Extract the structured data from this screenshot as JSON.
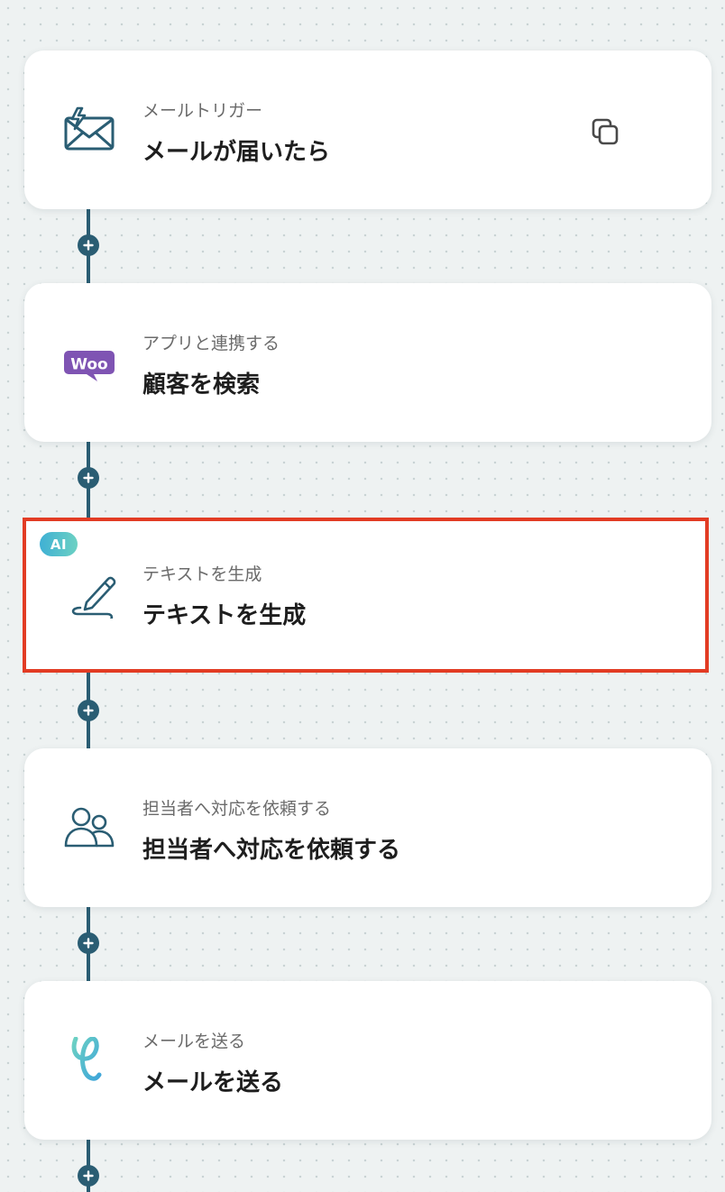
{
  "colors": {
    "accent_dark_teal": "#2a5d73",
    "selected_border": "#e23c24",
    "woo_purple": "#7f54b3",
    "ai_badge_gradient_start": "#3fb0d4",
    "ai_badge_gradient_end": "#6cd1c3"
  },
  "steps": [
    {
      "subtitle": "メールトリガー",
      "title": "メールが届いたら",
      "icon": "mail-trigger-icon",
      "has_copy_button": true
    },
    {
      "subtitle": "アプリと連携する",
      "title": "顧客を検索",
      "icon": "woocommerce-logo-icon",
      "logo_text": "Woo"
    },
    {
      "subtitle": "テキストを生成",
      "title": "テキストを生成",
      "icon": "pen-icon",
      "badge": "AI",
      "selected": true
    },
    {
      "subtitle": "担当者へ対応を依頼する",
      "title": "担当者へ対応を依頼する",
      "icon": "users-icon"
    },
    {
      "subtitle": "メールを送る",
      "title": "メールを送る",
      "icon": "yoom-mail-icon"
    }
  ]
}
